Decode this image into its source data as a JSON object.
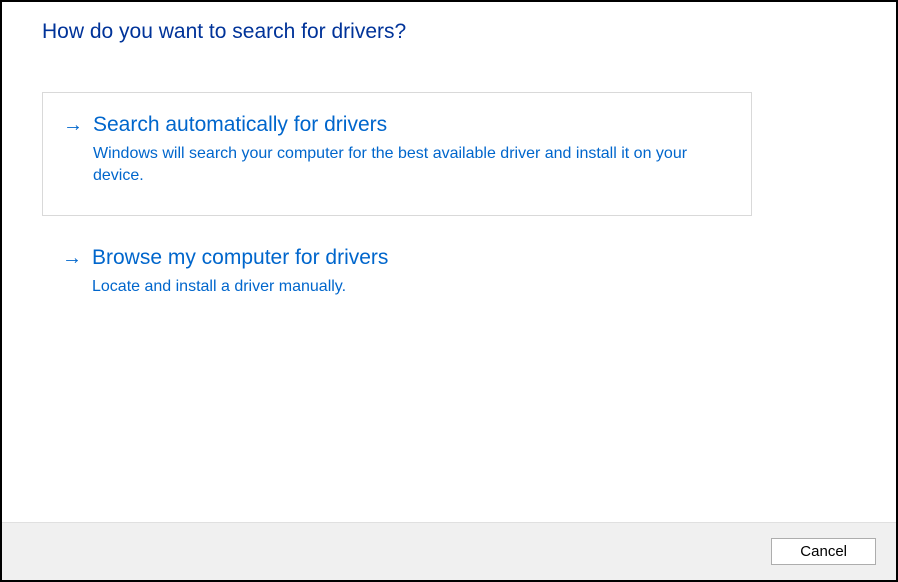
{
  "title": "How do you want to search for drivers?",
  "options": [
    {
      "title": "Search automatically for drivers",
      "description": "Windows will search your computer for the best available driver and install it on your device."
    },
    {
      "title": "Browse my computer for drivers",
      "description": "Locate and install a driver manually."
    }
  ],
  "footer": {
    "cancel_label": "Cancel"
  }
}
